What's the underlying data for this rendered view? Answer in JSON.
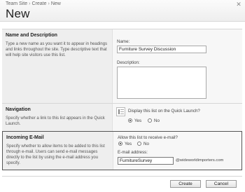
{
  "breadcrumb": {
    "site": "Team Site",
    "sep": "›",
    "create": "Create",
    "current": "New"
  },
  "page": {
    "title": "New"
  },
  "icons": {
    "close": "close-icon"
  },
  "name_section": {
    "title": "Name and Description",
    "desc": "Type a new name as you want it to appear in headings and links throughout the site. Type descriptive text that will help site visitors use this list.",
    "name_label": "Name:",
    "name_value": "Furniture Survey Discussion",
    "desc_label": "Description:",
    "desc_value": ""
  },
  "nav_section": {
    "title": "Navigation",
    "desc": "Specify whether a link to this list appears in the Quick Launch.",
    "question": "Display this list on the Quick Launch?",
    "yes": "Yes",
    "no": "No"
  },
  "email_section": {
    "title": "Incoming E-Mail",
    "desc": "Specify whether to allow items to be added to this list through e-mail. Users can send e-mail messages directly to the list by using the e-mail address you specify.",
    "question": "Allow this list to receive e-mail?",
    "yes": "Yes",
    "no": "No",
    "addr_label": "E-mail address:",
    "addr_value": "FurnitureSurvey",
    "domain": "@wideworldimporters.com"
  },
  "buttons": {
    "create": "Create",
    "cancel": "Cancel"
  }
}
